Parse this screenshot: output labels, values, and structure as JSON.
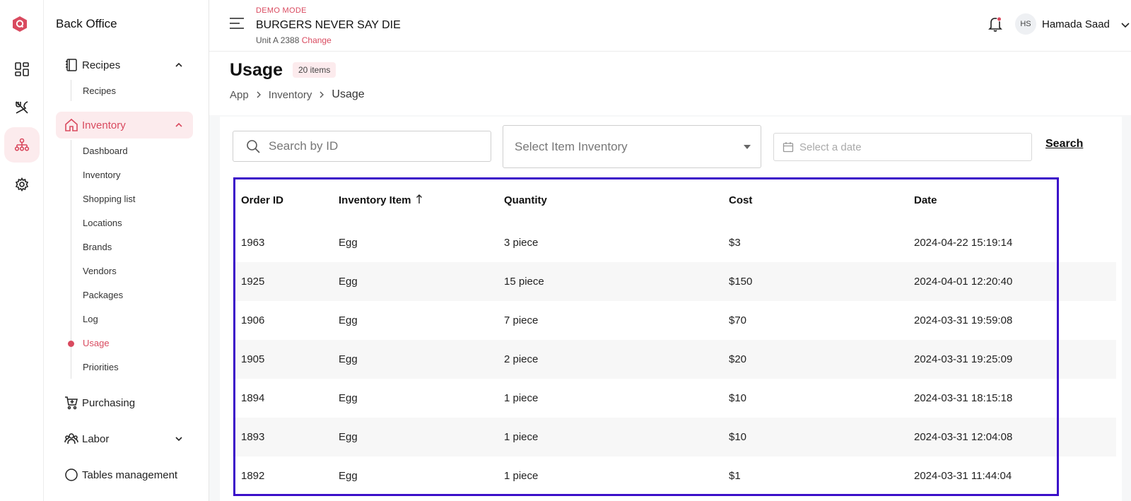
{
  "app": {
    "brand": "Back Office",
    "demo_label": "DEMO MODE",
    "business_name": "BURGERS NEVER SAY DIE",
    "unit": "Unit A 2388",
    "change_label": "Change",
    "user_initials": "HS",
    "user_name": "Hamada Saad"
  },
  "sidebar": {
    "recipes_group": "Recipes",
    "recipes_items": [
      "Recipes"
    ],
    "inventory_group": "Inventory",
    "inventory_items": [
      "Dashboard",
      "Inventory",
      "Shopping list",
      "Locations",
      "Brands",
      "Vendors",
      "Packages",
      "Log",
      "Usage",
      "Priorities"
    ],
    "purchasing": "Purchasing",
    "labor": "Labor",
    "tables": "Tables management"
  },
  "page": {
    "title": "Usage",
    "count_badge": "20 items",
    "breadcrumb": [
      "App",
      "Inventory",
      "Usage"
    ]
  },
  "filters": {
    "search_placeholder": "Search by ID",
    "select_placeholder": "Select Item Inventory",
    "date_placeholder": "Select a date",
    "search_button": "Search"
  },
  "table": {
    "columns": [
      "Order ID",
      "Inventory Item",
      "Quantity",
      "Cost",
      "Date"
    ],
    "rows": [
      [
        "1963",
        "Egg",
        "3 piece",
        "$3",
        "2024-04-22 15:19:14"
      ],
      [
        "1925",
        "Egg",
        "15 piece",
        "$150",
        "2024-04-01 12:20:40"
      ],
      [
        "1906",
        "Egg",
        "7 piece",
        "$70",
        "2024-03-31 19:59:08"
      ],
      [
        "1905",
        "Egg",
        "2 piece",
        "$20",
        "2024-03-31 19:25:09"
      ],
      [
        "1894",
        "Egg",
        "1 piece",
        "$10",
        "2024-03-31 18:15:18"
      ],
      [
        "1893",
        "Egg",
        "1 piece",
        "$10",
        "2024-03-31 12:04:08"
      ],
      [
        "1892",
        "Egg",
        "1 piece",
        "$1",
        "2024-03-31 11:44:04"
      ]
    ]
  },
  "colors": {
    "accent": "#d94a5f",
    "accent_bg": "#fcebed",
    "highlight": "#3b0fc9"
  },
  "icons": {
    "rail": [
      "logo-icon",
      "dashboard-icon",
      "utensils-icon",
      "org-chart-icon",
      "gear-icon"
    ]
  }
}
